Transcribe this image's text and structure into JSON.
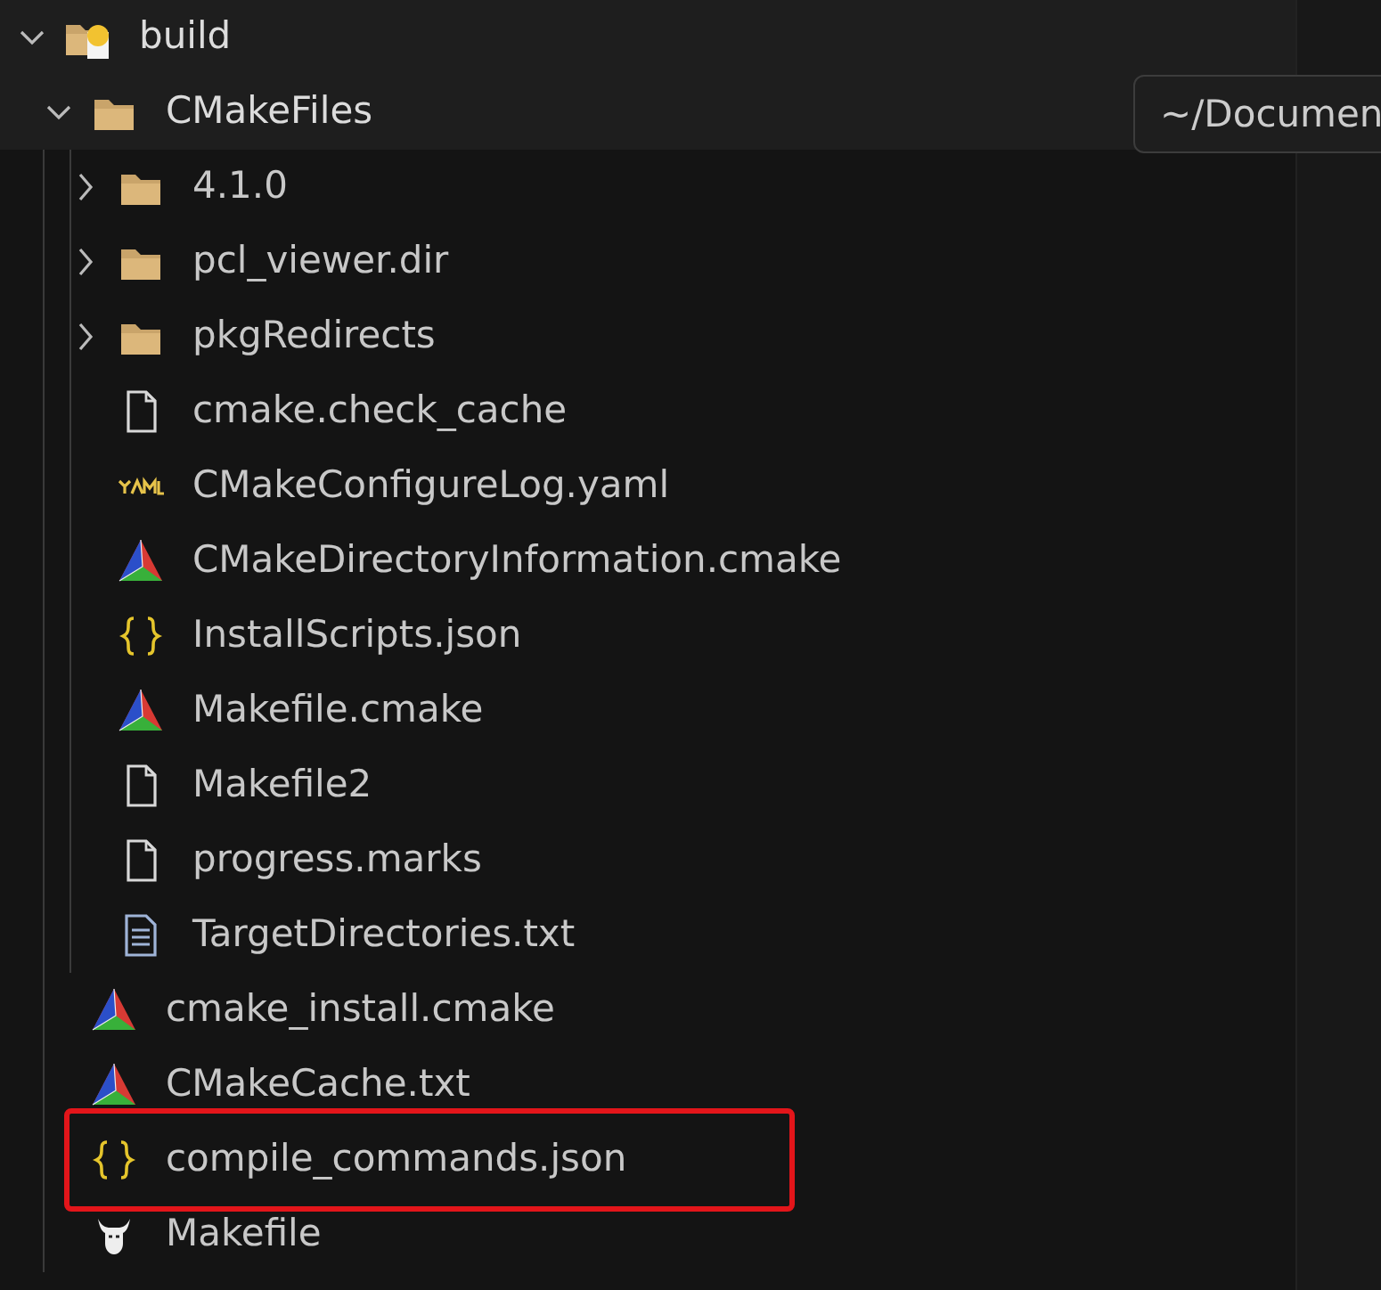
{
  "tree": [
    {
      "label": "build",
      "kind": "build-folder",
      "expanded": true,
      "sticky": true,
      "children": [
        {
          "label": "CMakeFiles",
          "kind": "folder",
          "expanded": true,
          "sticky": true,
          "children": [
            {
              "label": "4.1.0",
              "kind": "folder",
              "expanded": false
            },
            {
              "label": "pcl_viewer.dir",
              "kind": "folder",
              "expanded": false
            },
            {
              "label": "pkgRedirects",
              "kind": "folder",
              "expanded": false
            },
            {
              "label": "cmake.check_cache",
              "kind": "file"
            },
            {
              "label": "CMakeConfigureLog.yaml",
              "kind": "yaml"
            },
            {
              "label": "CMakeDirectoryInformation.cmake",
              "kind": "cmake"
            },
            {
              "label": "InstallScripts.json",
              "kind": "json"
            },
            {
              "label": "Makefile.cmake",
              "kind": "cmake"
            },
            {
              "label": "Makefile2",
              "kind": "file"
            },
            {
              "label": "progress.marks",
              "kind": "file"
            },
            {
              "label": "TargetDirectories.txt",
              "kind": "text"
            }
          ]
        },
        {
          "label": "cmake_install.cmake",
          "kind": "cmake"
        },
        {
          "label": "CMakeCache.txt",
          "kind": "cmake"
        },
        {
          "label": "compile_commands.json",
          "kind": "json",
          "highlighted": true
        },
        {
          "label": "Makefile",
          "kind": "gnu"
        }
      ]
    }
  ],
  "tooltip": {
    "text": "~/Documen"
  }
}
